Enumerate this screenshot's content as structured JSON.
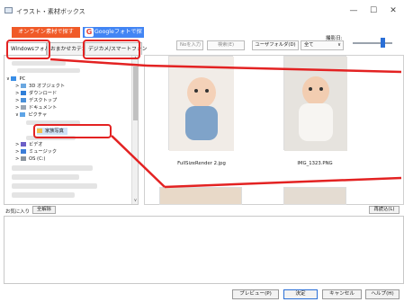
{
  "window": {
    "title": "イラスト・素材ボックス",
    "minimize": "—",
    "maximize": "☐",
    "close": "✕"
  },
  "source_buttons": {
    "online": "オンライン素材で探す",
    "google": "Googleフォトで探す",
    "google_g": "G"
  },
  "tabs": [
    {
      "label": "Windowsフォルダ",
      "active": true
    },
    {
      "label": "おまかせカテゴリ",
      "active": false
    },
    {
      "label": "デジカメ/スマートフォン",
      "active": false
    }
  ],
  "tree": {
    "items": [
      {
        "label": "PC",
        "icon": "pc-icon",
        "level": 0,
        "arrow": "∨"
      },
      {
        "label": "3D オブジェクト",
        "icon": "cube-icon",
        "level": 1,
        "arrow": ">"
      },
      {
        "label": "ダウンロード",
        "icon": "download-icon",
        "level": 1,
        "arrow": ">"
      },
      {
        "label": "デスクトップ",
        "icon": "desktop-icon",
        "level": 1,
        "arrow": ">"
      },
      {
        "label": "ドキュメント",
        "icon": "document-icon",
        "level": 1,
        "arrow": ">"
      },
      {
        "label": "ピクチャ",
        "icon": "picture-icon",
        "level": 1,
        "arrow": "∨"
      },
      {
        "label": "家族写真",
        "icon": "folder-icon",
        "level": 2,
        "arrow": "",
        "selected": true
      },
      {
        "label": "ビデオ",
        "icon": "video-icon",
        "level": 1,
        "arrow": ">"
      },
      {
        "label": "ミュージック",
        "icon": "music-icon",
        "level": 1,
        "arrow": ">"
      },
      {
        "label": "OS (C:)",
        "icon": "drive-icon",
        "level": 1,
        "arrow": ">"
      }
    ],
    "scroll_up": "∧",
    "scroll_down": "∨"
  },
  "toolbar": {
    "search_placeholder": "Noを入力",
    "search_button": "検索(E)",
    "user_folder": "ユーザフォルダ(D)",
    "date_label": "撮影日:",
    "date_value": "全て",
    "date_arrow": "∨"
  },
  "thumbnails": [
    {
      "caption": "FullSizeRender 2.jpg"
    },
    {
      "caption": "IMG_1323.PNG"
    }
  ],
  "bottom": {
    "favorites": "お気に入り",
    "clear_all": "全解除",
    "reload": "再読込(L)"
  },
  "footer": {
    "preview": "プレビュー(P)",
    "ok": "決定",
    "cancel": "キャンセル",
    "help": "ヘルプ(H)"
  },
  "colors": {
    "accent": "#2b6fd6",
    "highlight": "#e32222",
    "online_button": "#f05a28",
    "google_button": "#4285f4"
  }
}
